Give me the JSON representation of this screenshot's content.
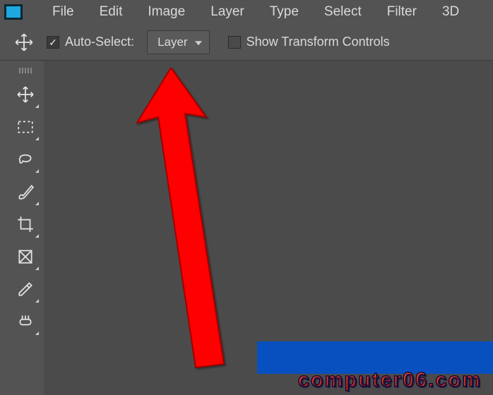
{
  "menubar": {
    "items": [
      "File",
      "Edit",
      "Image",
      "Layer",
      "Type",
      "Select",
      "Filter",
      "3D"
    ]
  },
  "options": {
    "auto_select_label": "Auto-Select:",
    "auto_select_checked": true,
    "dropdown_value": "Layer",
    "show_transform_label": "Show Transform Controls",
    "show_transform_checked": false
  },
  "tools": [
    {
      "name": "move-tool"
    },
    {
      "name": "marquee-tool"
    },
    {
      "name": "lasso-tool"
    },
    {
      "name": "brush-tool"
    },
    {
      "name": "crop-tool"
    },
    {
      "name": "frame-tool"
    },
    {
      "name": "eyedropper-tool"
    },
    {
      "name": "healing-brush-tool"
    }
  ],
  "watermark": {
    "text": "computer06.com"
  }
}
